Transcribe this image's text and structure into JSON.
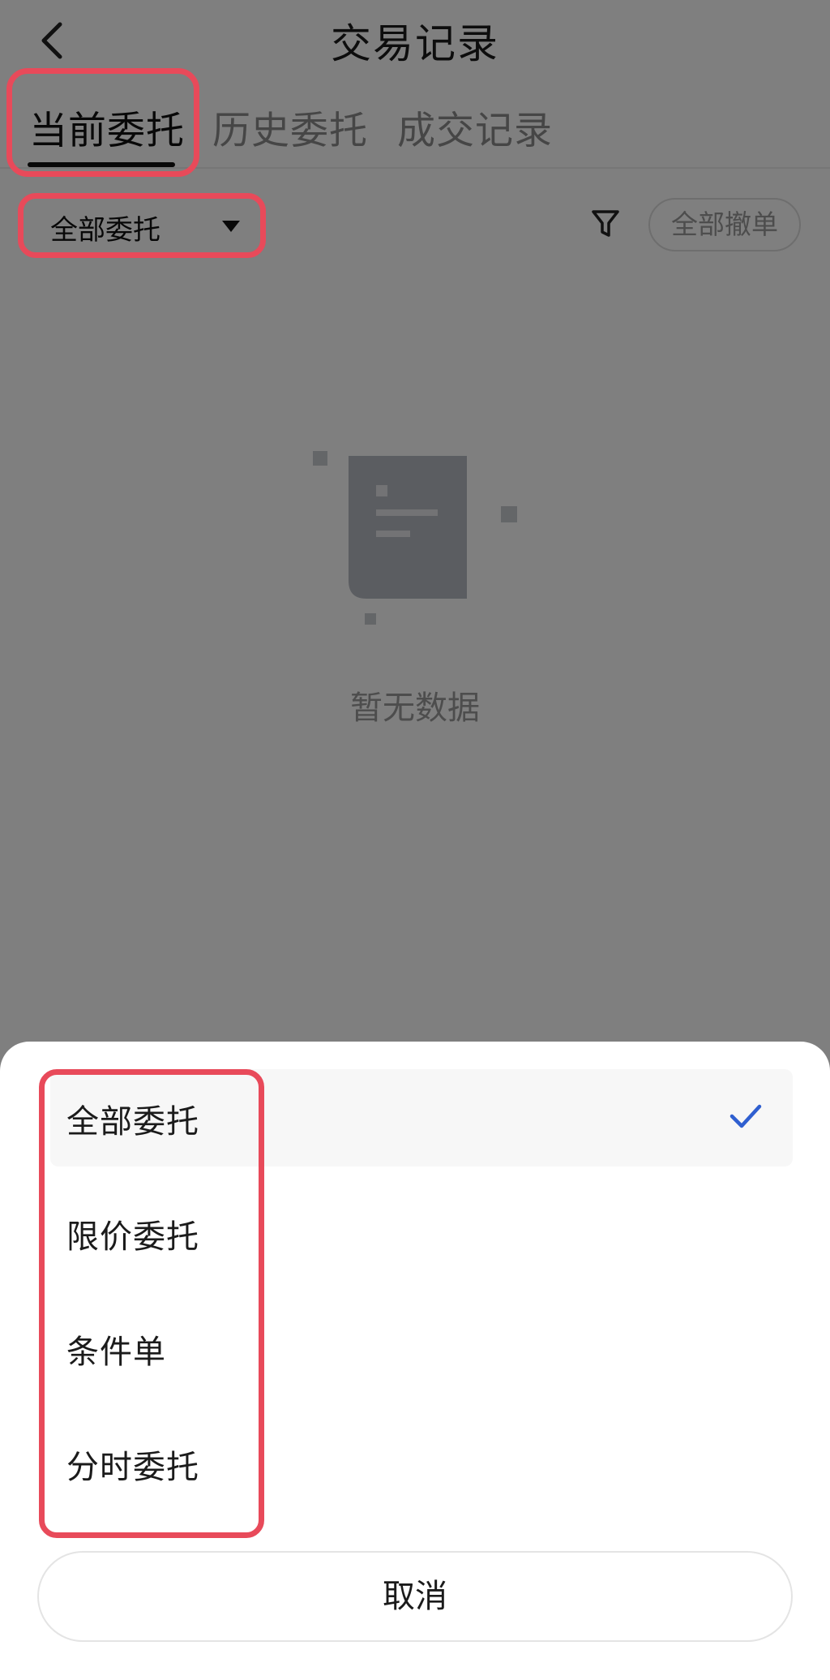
{
  "header": {
    "title": "交易记录"
  },
  "tabs": [
    {
      "label": "当前委托",
      "active": true
    },
    {
      "label": "历史委托",
      "active": false
    },
    {
      "label": "成交记录",
      "active": false
    }
  ],
  "filter": {
    "dropdown_value": "全部委托",
    "cancel_all_label": "全部撤单"
  },
  "empty": {
    "text": "暂无数据"
  },
  "sheet": {
    "options": [
      {
        "label": "全部委托",
        "selected": true
      },
      {
        "label": "限价委托",
        "selected": false
      },
      {
        "label": "条件单",
        "selected": false
      },
      {
        "label": "分时委托",
        "selected": false
      }
    ],
    "cancel_label": "取消"
  },
  "colors": {
    "highlight": "#e84a5a",
    "check": "#2f5fd0",
    "overlay": "rgba(0,0,0,0.5)"
  }
}
